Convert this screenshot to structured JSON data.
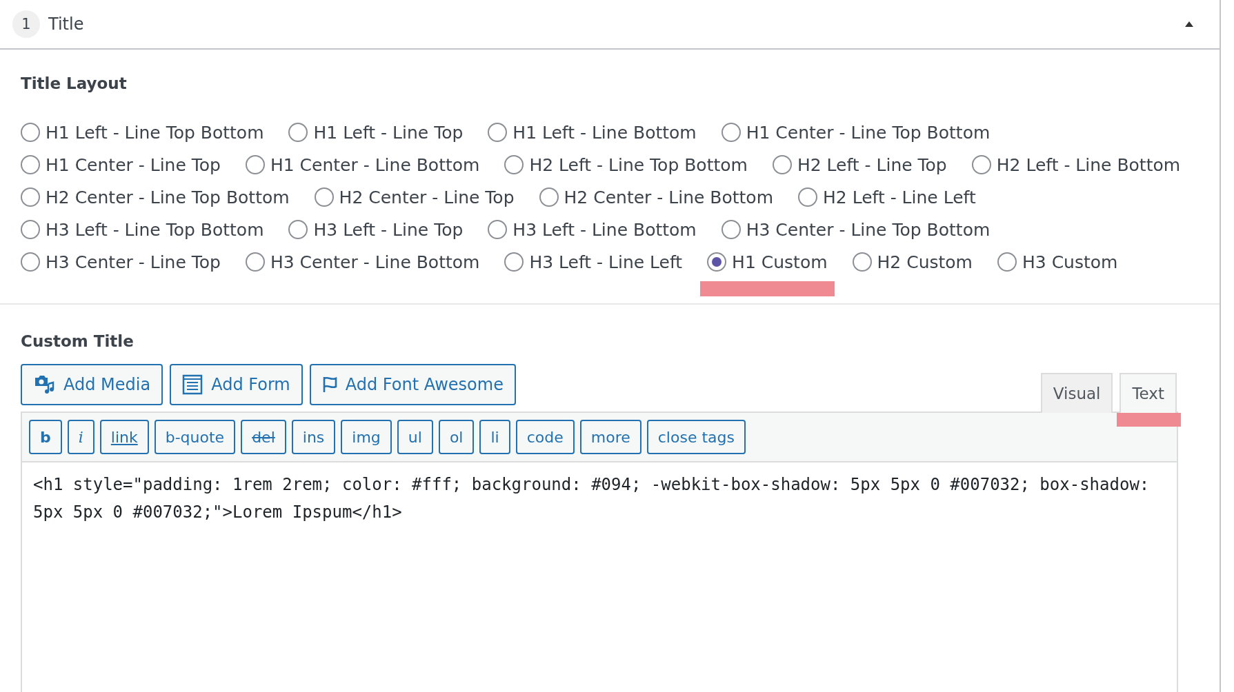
{
  "header": {
    "number": "1",
    "title": "Title",
    "expanded": true
  },
  "title_layout": {
    "label": "Title Layout",
    "options": [
      {
        "label": "H1 Left - Line Top Bottom",
        "selected": false
      },
      {
        "label": "H1 Left - Line Top",
        "selected": false
      },
      {
        "label": "H1 Left - Line Bottom",
        "selected": false
      },
      {
        "label": "H1 Center - Line Top Bottom",
        "selected": false
      },
      {
        "label": "H1 Center - Line Top",
        "selected": false
      },
      {
        "label": "H1 Center - Line Bottom",
        "selected": false
      },
      {
        "label": "H2 Left - Line Top Bottom",
        "selected": false
      },
      {
        "label": "H2 Left - Line Top",
        "selected": false
      },
      {
        "label": "H2 Left - Line Bottom",
        "selected": false
      },
      {
        "label": "H2 Center - Line Top Bottom",
        "selected": false
      },
      {
        "label": "H2 Center - Line Top",
        "selected": false
      },
      {
        "label": "H2 Center - Line Bottom",
        "selected": false
      },
      {
        "label": "H2 Left - Line Left",
        "selected": false
      },
      {
        "label": "H3 Left - Line Top Bottom",
        "selected": false
      },
      {
        "label": "H3 Left - Line Top",
        "selected": false
      },
      {
        "label": "H3 Left - Line Bottom",
        "selected": false
      },
      {
        "label": "H3 Center - Line Top Bottom",
        "selected": false
      },
      {
        "label": "H3 Center - Line Top",
        "selected": false
      },
      {
        "label": "H3 Center - Line Bottom",
        "selected": false
      },
      {
        "label": "H3 Left - Line Left",
        "selected": false
      },
      {
        "label": "H1 Custom",
        "selected": true
      },
      {
        "label": "H2 Custom",
        "selected": false
      },
      {
        "label": "H3 Custom",
        "selected": false
      }
    ]
  },
  "custom_title": {
    "label": "Custom Title",
    "media_buttons": [
      {
        "kind": "media",
        "label": "Add Media"
      },
      {
        "kind": "form",
        "label": "Add Form"
      },
      {
        "kind": "flag",
        "label": "Add Font Awesome"
      }
    ],
    "tabs": [
      {
        "label": "Visual",
        "selected": false
      },
      {
        "label": "Text",
        "selected": true
      }
    ],
    "quicktags": [
      {
        "kind": "bold",
        "label": "b"
      },
      {
        "kind": "italic",
        "label": "i"
      },
      {
        "kind": "link",
        "label": "link"
      },
      {
        "kind": "plain",
        "label": "b-quote"
      },
      {
        "kind": "strike",
        "label": "del"
      },
      {
        "kind": "plain",
        "label": "ins"
      },
      {
        "kind": "plain",
        "label": "img"
      },
      {
        "kind": "plain",
        "label": "ul"
      },
      {
        "kind": "plain",
        "label": "ol"
      },
      {
        "kind": "plain",
        "label": "li"
      },
      {
        "kind": "plain",
        "label": "code"
      },
      {
        "kind": "plain",
        "label": "more"
      },
      {
        "kind": "plain",
        "label": "close tags"
      }
    ],
    "content": "<h1 style=\"padding: 1rem 2rem; color: #fff; background: #094; -webkit-box-shadow: 5px 5px 0 #007032; box-shadow: 5px 5px 0 #007032;\">Lorem Ipspum</h1>"
  }
}
